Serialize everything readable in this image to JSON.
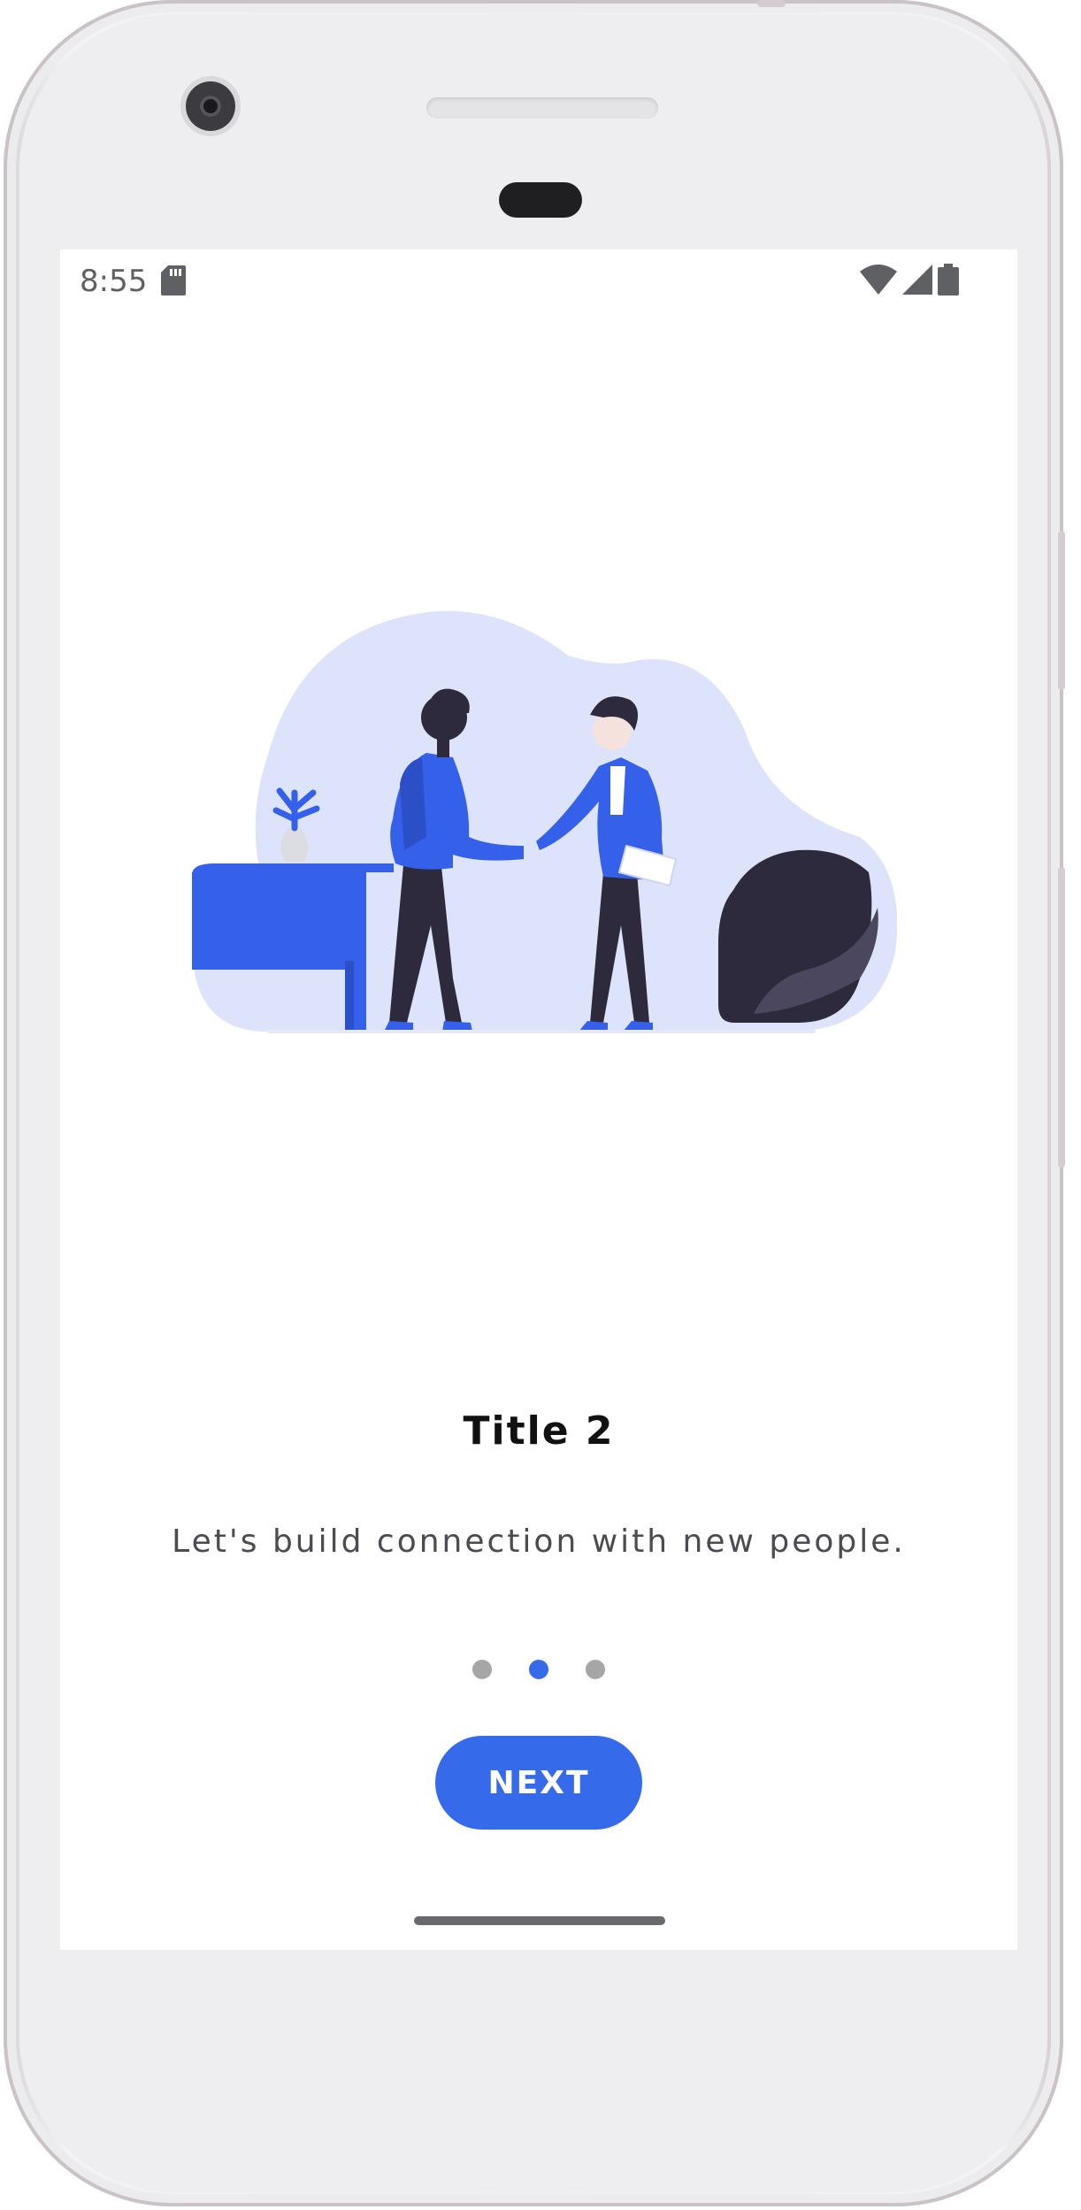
{
  "status_bar": {
    "time": "8:55",
    "icons": [
      "sd-card-icon",
      "wifi-icon",
      "signal-icon",
      "battery-icon"
    ]
  },
  "onboarding": {
    "illustration": "handshake-illustration",
    "title": "Title 2",
    "subtitle": "Let's build connection with new people.",
    "page_indicator": {
      "total_pages": 3,
      "current_page": 2
    },
    "next_label": "NEXT"
  },
  "colors": {
    "accent": "#356BEA",
    "inactive_dot": "#A6A6A6",
    "blob_background": "#DCE3FB",
    "dark_figure": "#2C2A3C"
  }
}
